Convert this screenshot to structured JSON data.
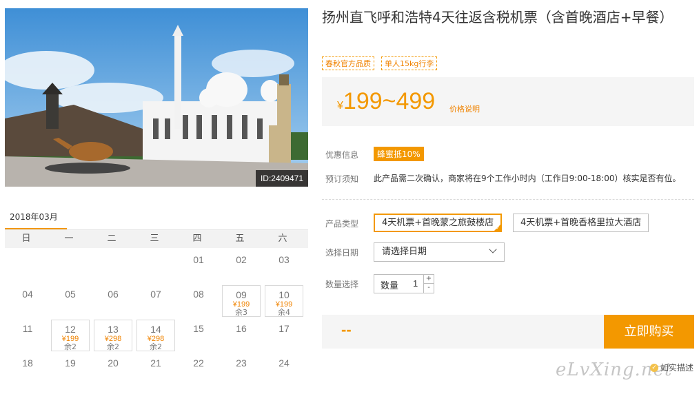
{
  "product": {
    "title": "扬州直飞呼和浩特4天往返含税机票（含首晚酒店+早餐）",
    "tags": [
      "春秋官方品质",
      "单人15kg行李"
    ],
    "image_id": "ID:2409471"
  },
  "price": {
    "currency": "¥",
    "range": "199~499",
    "note": "价格说明"
  },
  "promo": {
    "label": "优惠信息",
    "badge": "蜂蜜抵10%"
  },
  "booking_notice": {
    "label": "预订须知",
    "text": "此产品需二次确认，商家将在9个工作小时内（工作日9:00-18:00）核实是否有位。"
  },
  "options": {
    "product_type_label": "产品类型",
    "types": [
      "4天机票+首晚蒙之旅鼓楼店",
      "4天机票+首晚香格里拉大酒店"
    ],
    "selected_index": 0,
    "date_label": "选择日期",
    "date_placeholder": "请选择日期",
    "quantity_label": "数量选择",
    "quantity_field_label": "数量",
    "quantity_value": "1",
    "qty_plus": "+",
    "qty_minus": "-"
  },
  "total": "--",
  "buy_button": "立即购买",
  "verify_text": "如实描述",
  "watermark": "eLvXing.net",
  "calendar": {
    "month": "2018年03月",
    "weekdays": [
      "日",
      "一",
      "二",
      "三",
      "四",
      "五",
      "六"
    ],
    "weeks": [
      [
        null,
        null,
        null,
        null,
        {
          "d": "01"
        },
        {
          "d": "02"
        },
        {
          "d": "03"
        }
      ],
      [
        {
          "d": "04"
        },
        {
          "d": "05"
        },
        {
          "d": "06"
        },
        {
          "d": "07"
        },
        {
          "d": "08"
        },
        {
          "d": "09",
          "p": "¥199",
          "r": "余3"
        },
        {
          "d": "10",
          "p": "¥199",
          "r": "余4"
        }
      ],
      [
        {
          "d": "11"
        },
        {
          "d": "12",
          "p": "¥199",
          "r": "余2"
        },
        {
          "d": "13",
          "p": "¥298",
          "r": "余2"
        },
        {
          "d": "14",
          "p": "¥298",
          "r": "余2"
        },
        {
          "d": "15"
        },
        {
          "d": "16"
        },
        {
          "d": "17"
        }
      ],
      [
        {
          "d": "18"
        },
        {
          "d": "19"
        },
        {
          "d": "20"
        },
        {
          "d": "21"
        },
        {
          "d": "22"
        },
        {
          "d": "23"
        },
        {
          "d": "24"
        }
      ]
    ]
  },
  "colors": {
    "accent": "#f39800",
    "price": "#f08300",
    "panel_bg": "#f5f5f5"
  }
}
